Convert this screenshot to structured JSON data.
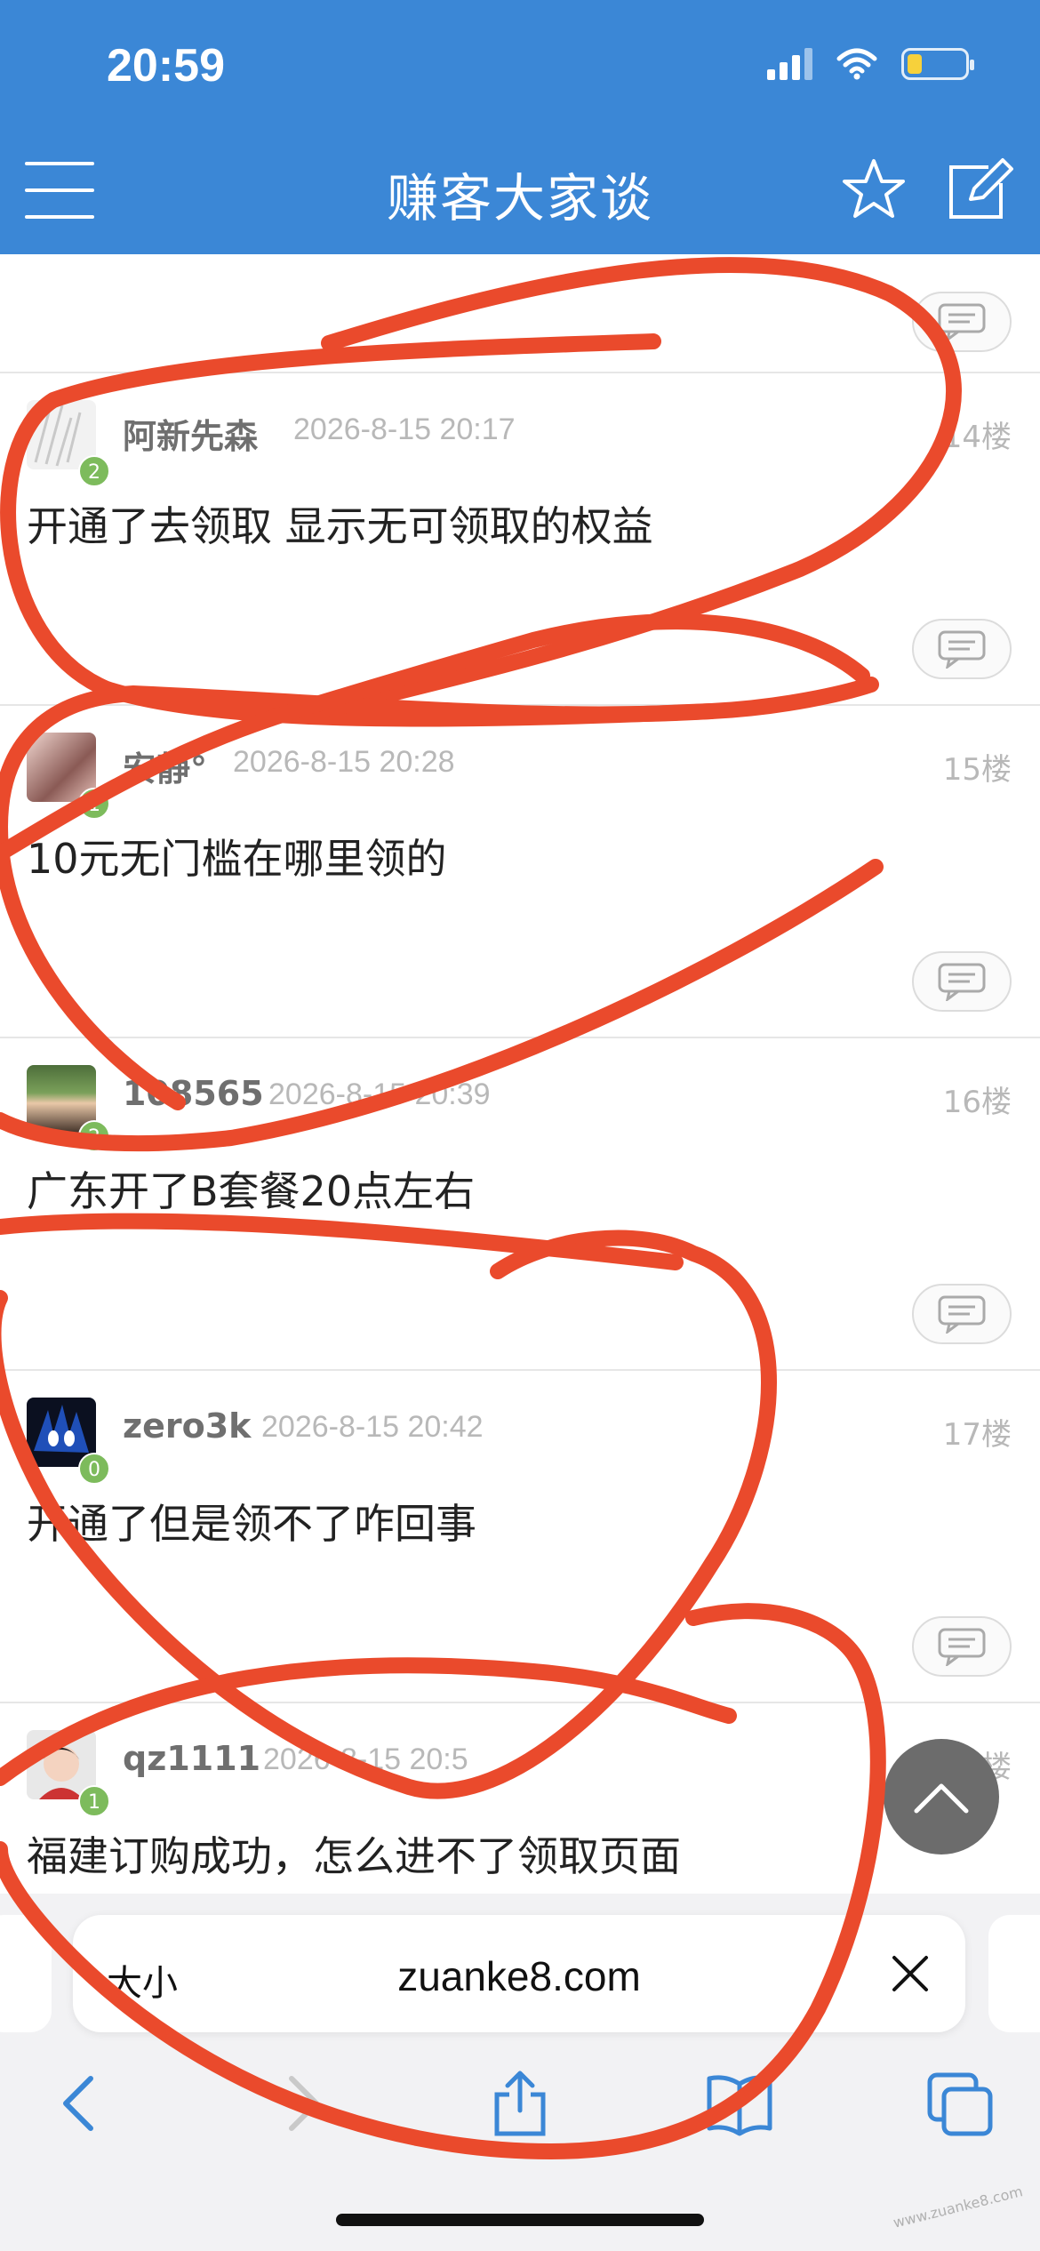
{
  "status_bar": {
    "time": "20:59"
  },
  "header": {
    "title": "赚客大家谈"
  },
  "posts": [
    {
      "username": "阿新先森",
      "time": "2026-8-15 20:17",
      "floor": "14楼",
      "level": "2",
      "content": "开通了去领取 显示无可领取的权益"
    },
    {
      "username": "安静°",
      "time": "2026-8-15 20:28",
      "floor": "15楼",
      "level": "1",
      "content": "10元无门槛在哪里领的"
    },
    {
      "username": "108565",
      "time": "2026-8-15 20:39",
      "floor": "16楼",
      "level": "2",
      "content": "广东开了B套餐20点左右"
    },
    {
      "username": "zero3k",
      "time": "2026-8-15 20:42",
      "floor": "17楼",
      "level": "0",
      "content": "开通了但是领不了咋回事"
    },
    {
      "username": "qz1111",
      "time": "2026-8-15 20:5",
      "floor": "18楼",
      "level": "1",
      "content": "福建订购成功，怎么进不了领取页面"
    }
  ],
  "browser": {
    "text_size_label": "大小",
    "url": "zuanke8.com"
  },
  "watermark": "www.zuanke8.com",
  "colors": {
    "header": "#3b87d6",
    "level_badge": "#7dbb5c",
    "scribble": "#ea4a2c"
  }
}
